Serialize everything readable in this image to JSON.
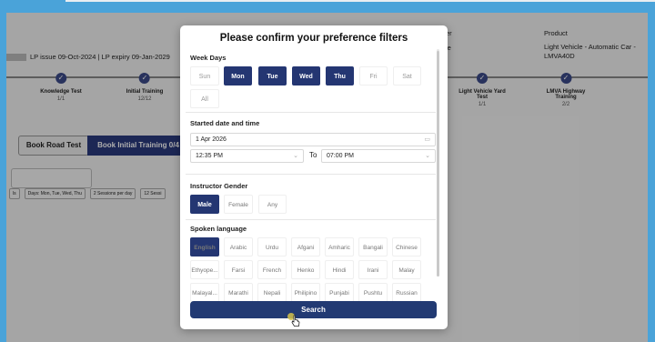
{
  "background": {
    "lp_line": "LP issue 09-Oct-2024 | LP expiry 09-Jan-2029",
    "header_right_1": "er",
    "header_right_2": "le",
    "product_label": "Product",
    "product_value": "Light Vehicle - Automatic Car - LMVA40D",
    "steps": [
      {
        "name": "Knowledge Test",
        "count": "1/1"
      },
      {
        "name": "Initial Training",
        "count": "12/12"
      },
      {
        "name": "Light Vehicle Yard Test",
        "count": "1/1"
      },
      {
        "name": "LMVA Highway Training",
        "count": "2/2"
      }
    ],
    "tab_road": "Book Road Test",
    "tab_initial": "Book Initial Training 0/4",
    "chips": [
      "ls",
      "Days: Mon, Tue, Wed, Thu",
      "2 Sessions per day",
      "12 Sessi"
    ]
  },
  "modal": {
    "title": "Please confirm your preference filters",
    "week_days_label": "Week Days",
    "days": [
      {
        "label": "Sun",
        "selected": false
      },
      {
        "label": "Mon",
        "selected": true
      },
      {
        "label": "Tue",
        "selected": true
      },
      {
        "label": "Wed",
        "selected": true
      },
      {
        "label": "Thu",
        "selected": true
      },
      {
        "label": "Fri",
        "selected": false
      },
      {
        "label": "Sat",
        "selected": false
      },
      {
        "label": "All",
        "selected": false
      }
    ],
    "start_label": "Started date and time",
    "date_value": "1 Apr  2026",
    "time_from": "12:35 PM",
    "to_label": "To",
    "time_to": "07:00 PM",
    "gender_label": "Instructor Gender",
    "genders": [
      {
        "label": "Male",
        "selected": true
      },
      {
        "label": "Female",
        "selected": false
      },
      {
        "label": "Any",
        "selected": false
      }
    ],
    "language_label": "Spoken language",
    "languages": [
      {
        "label": "English",
        "selected": true
      },
      {
        "label": "Arabic",
        "selected": false
      },
      {
        "label": "Urdu",
        "selected": false
      },
      {
        "label": "Afgani",
        "selected": false
      },
      {
        "label": "Amharic",
        "selected": false
      },
      {
        "label": "Bangali",
        "selected": false
      },
      {
        "label": "Chinese",
        "selected": false
      },
      {
        "label": "Ethyope...",
        "selected": false
      },
      {
        "label": "Farsi",
        "selected": false
      },
      {
        "label": "French",
        "selected": false
      },
      {
        "label": "Henko",
        "selected": false
      },
      {
        "label": "Hindi",
        "selected": false
      },
      {
        "label": "Irani",
        "selected": false
      },
      {
        "label": "Malay",
        "selected": false
      },
      {
        "label": "Malayal...",
        "selected": false
      },
      {
        "label": "Marathi",
        "selected": false
      },
      {
        "label": "Nepali",
        "selected": false
      },
      {
        "label": "Philipino",
        "selected": false
      },
      {
        "label": "Punjabi",
        "selected": false
      },
      {
        "label": "Pushtu",
        "selected": false
      },
      {
        "label": "Russian",
        "selected": false
      }
    ],
    "search_label": "Search"
  },
  "colors": {
    "frame": "#4aa3d9",
    "accent": "#243672"
  }
}
